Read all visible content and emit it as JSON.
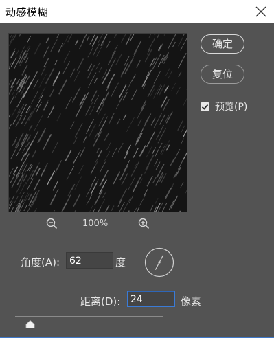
{
  "window": {
    "title": "动感模糊"
  },
  "buttons": {
    "ok_label": "确定",
    "reset_label": "复位"
  },
  "preview_checkbox": {
    "label": "预览(P)",
    "checked": true
  },
  "zoom": {
    "level": "100%"
  },
  "angle": {
    "label": "角度(A):",
    "value": "62",
    "unit": "度"
  },
  "distance": {
    "label": "距离(D):",
    "value": "24",
    "unit": "像素",
    "slider_fraction": 0.1
  },
  "colors": {
    "dialog_bg": "#535353",
    "titlebar_bg": "#ffffff",
    "field_bg": "#454545",
    "focus_border": "#3b7bd6",
    "preview_bg": "#141414"
  },
  "icons": {
    "close": "close-icon",
    "zoom_out": "zoom-out-icon",
    "zoom_in": "zoom-in-icon",
    "checkbox": "check-icon",
    "dial": "angle-dial-icon",
    "slider_thumb": "slider-thumb-icon"
  }
}
